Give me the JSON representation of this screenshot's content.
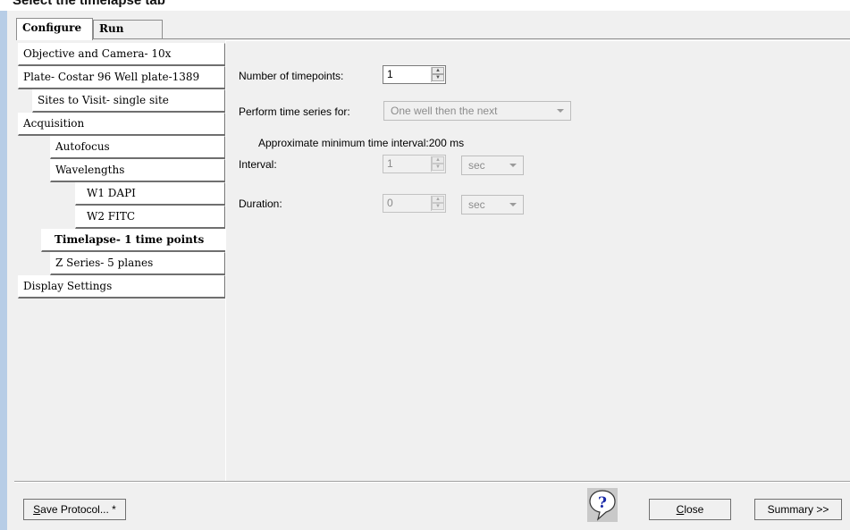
{
  "header_text": "Select the timelapse tab",
  "tabs": [
    {
      "label": "Configure",
      "active": true
    },
    {
      "label": "Run",
      "active": false
    }
  ],
  "nav": {
    "items": [
      {
        "label": "Objective and Camera- 10x",
        "indent": 0,
        "active": false
      },
      {
        "label": "Plate- Costar 96 Well plate-1389",
        "indent": 0,
        "active": false
      },
      {
        "label": "Sites to Visit- single site",
        "indent": 1,
        "active": false
      },
      {
        "label": "Acquisition",
        "indent": 0,
        "active": false
      },
      {
        "label": "Autofocus",
        "indent": 1,
        "active": false
      },
      {
        "label": "Wavelengths",
        "indent": 1,
        "active": false
      },
      {
        "label": "W1 DAPI",
        "indent": 2,
        "active": false
      },
      {
        "label": "W2 FITC",
        "indent": 2,
        "active": false
      },
      {
        "label": "Timelapse- 1 time points",
        "indent": 1,
        "active": true
      },
      {
        "label": "Z Series- 5 planes",
        "indent": 1,
        "active": false
      },
      {
        "label": "Display Settings",
        "indent": 0,
        "active": false
      }
    ]
  },
  "timelapse": {
    "num_timepoints_label": "Number of timepoints:",
    "num_timepoints_value": "1",
    "perform_series_label": "Perform time series for:",
    "perform_series_value": "One well then the next",
    "approx_interval_text": "Approximate minimum time interval:200 ms",
    "interval_label": "Interval:",
    "interval_value": "1",
    "interval_unit": "sec",
    "duration_label": "Duration:",
    "duration_value": "0",
    "duration_unit": "sec"
  },
  "footer": {
    "save_protocol_label": "ave Protocol... *",
    "save_protocol_mnemonic": "S",
    "close_label": "lose",
    "close_mnemonic": "C",
    "summary_label": "Summary >>",
    "help_icon": "help-question-bubble-icon"
  },
  "colors": {
    "accent_strip": "#b7cde6",
    "window_bg": "#f0f0f0",
    "help_icon_fill": "#1a2aa8"
  }
}
